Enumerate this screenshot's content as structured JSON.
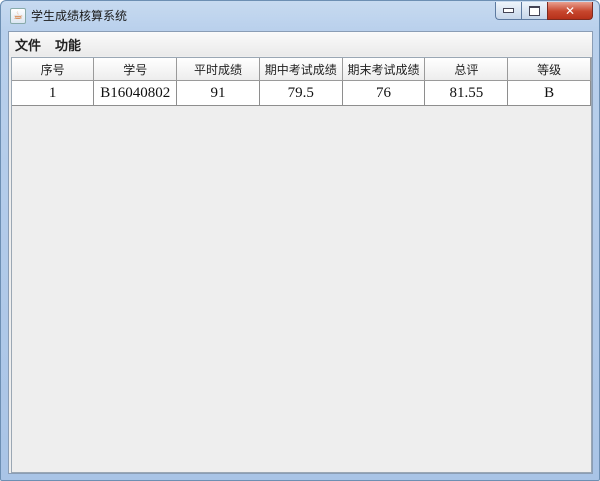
{
  "window": {
    "title": "学生成绩核算系统",
    "icon": "java-cup-icon",
    "buttons": {
      "minimize": "minimize",
      "maximize": "maximize",
      "close": "✕"
    }
  },
  "menu": {
    "items": [
      "文件",
      "功能"
    ]
  },
  "table": {
    "columns": [
      "序号",
      "学号",
      "平时成绩",
      "期中考试成绩",
      "期末考试成绩",
      "总评",
      "等级"
    ],
    "rows": [
      [
        "1",
        "B16040802",
        "91",
        "79.5",
        "76",
        "81.55",
        "B"
      ]
    ]
  },
  "colors": {
    "title_gradient": "#b9d0ec",
    "close_button": "#c7462d",
    "client_bg": "#eeeeee"
  }
}
